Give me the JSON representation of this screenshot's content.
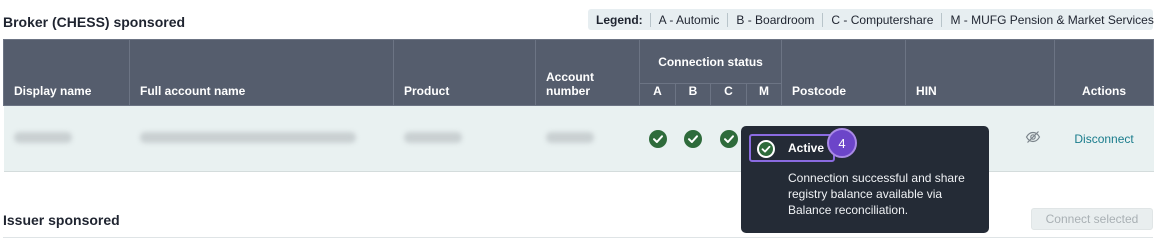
{
  "broker": {
    "title": "Broker (CHESS) sponsored"
  },
  "legend": {
    "title": "Legend:",
    "items": [
      "A - Automic",
      "B - Boardroom",
      "C - Computershare",
      "M - MUFG Pension & Market Services"
    ]
  },
  "table": {
    "headers": {
      "display_name": "Display name",
      "full_account_name": "Full account name",
      "product": "Product",
      "account_number": "Account number",
      "connection_status": "Connection status",
      "a": "A",
      "b": "B",
      "c": "C",
      "m": "M",
      "postcode": "Postcode",
      "hin": "HIN",
      "actions": "Actions"
    },
    "row": {
      "statuses": [
        "active",
        "active",
        "active",
        "active"
      ],
      "action": "Disconnect"
    }
  },
  "tooltip": {
    "status": "Active",
    "badge": "4",
    "text": "Connection successful and share registry balance available via Balance reconciliation."
  },
  "issuer": {
    "title": "Issuer sponsored",
    "connect_selected": "Connect selected"
  },
  "colors": {
    "header_bg": "#555d6d",
    "row_bg": "#e9f1f1",
    "status_active": "#2e6b3b",
    "link": "#1a7c8c",
    "tooltip_bg": "#242b36",
    "badge": "#6c45c9"
  }
}
